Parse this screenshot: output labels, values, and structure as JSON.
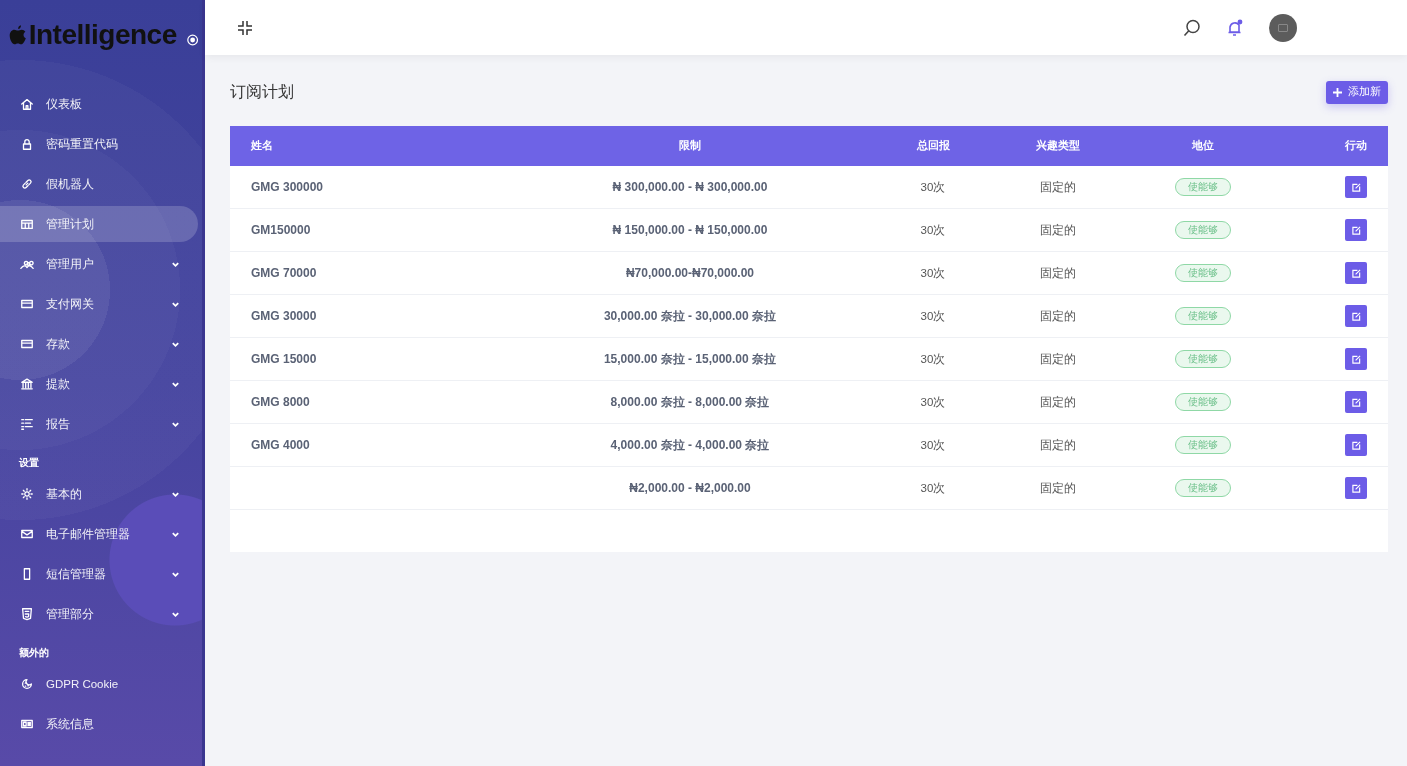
{
  "brand": {
    "name": "Intelligence"
  },
  "sidebar": {
    "sections": [
      {
        "items": [
          {
            "label": "仪表板",
            "selected": false,
            "expandable": false
          },
          {
            "label": "密码重置代码",
            "selected": false,
            "expandable": false
          },
          {
            "label": "假机器人",
            "selected": false,
            "expandable": false
          },
          {
            "label": "管理计划",
            "selected": true,
            "expandable": false
          },
          {
            "label": "管理用户",
            "selected": false,
            "expandable": true
          },
          {
            "label": "支付网关",
            "selected": false,
            "expandable": true
          },
          {
            "label": "存款",
            "selected": false,
            "expandable": true
          },
          {
            "label": "提款",
            "selected": false,
            "expandable": true
          },
          {
            "label": "报告",
            "selected": false,
            "expandable": true
          }
        ]
      },
      {
        "heading": "设置",
        "items": [
          {
            "label": "基本的",
            "selected": false,
            "expandable": true
          },
          {
            "label": "电子邮件管理器",
            "selected": false,
            "expandable": true
          },
          {
            "label": "短信管理器",
            "selected": false,
            "expandable": true
          },
          {
            "label": "管理部分",
            "selected": false,
            "expandable": true
          }
        ]
      },
      {
        "heading": "额外的",
        "items": [
          {
            "label": "GDPR Cookie",
            "selected": false,
            "expandable": false
          },
          {
            "label": "系统信息",
            "selected": false,
            "expandable": false
          }
        ]
      }
    ]
  },
  "page": {
    "title": "订阅计划",
    "add_button": "添加新"
  },
  "table": {
    "columns": [
      "姓名",
      "限制",
      "总回报",
      "兴趣类型",
      "地位",
      "行动"
    ],
    "rows": [
      {
        "name": "GMG 300000",
        "limit": "₦ 300,000.00 - ₦ 300,000.00",
        "total_return": "30次",
        "interest_type": "固定的",
        "status": "使能够"
      },
      {
        "name": "GM150000",
        "limit": "₦ 150,000.00 - ₦ 150,000.00",
        "total_return": "30次",
        "interest_type": "固定的",
        "status": "使能够"
      },
      {
        "name": "GMG 70000",
        "limit": "₦70,000.00-₦70,000.00",
        "total_return": "30次",
        "interest_type": "固定的",
        "status": "使能够"
      },
      {
        "name": "GMG 30000",
        "limit": "30,000.00 奈拉 - 30,000.00 奈拉",
        "total_return": "30次",
        "interest_type": "固定的",
        "status": "使能够"
      },
      {
        "name": "GMG 15000",
        "limit": "15,000.00 奈拉 - 15,000.00 奈拉",
        "total_return": "30次",
        "interest_type": "固定的",
        "status": "使能够"
      },
      {
        "name": "GMG 8000",
        "limit": "8,000.00 奈拉 - 8,000.00 奈拉",
        "total_return": "30次",
        "interest_type": "固定的",
        "status": "使能够"
      },
      {
        "name": "GMG 4000",
        "limit": "4,000.00 奈拉 - 4,000.00 奈拉",
        "total_return": "30次",
        "interest_type": "固定的",
        "status": "使能够"
      },
      {
        "limit": "₦2,000.00 - ₦2,000.00",
        "total_return": "30次",
        "interest_type": "固定的",
        "status": "使能够"
      }
    ]
  }
}
